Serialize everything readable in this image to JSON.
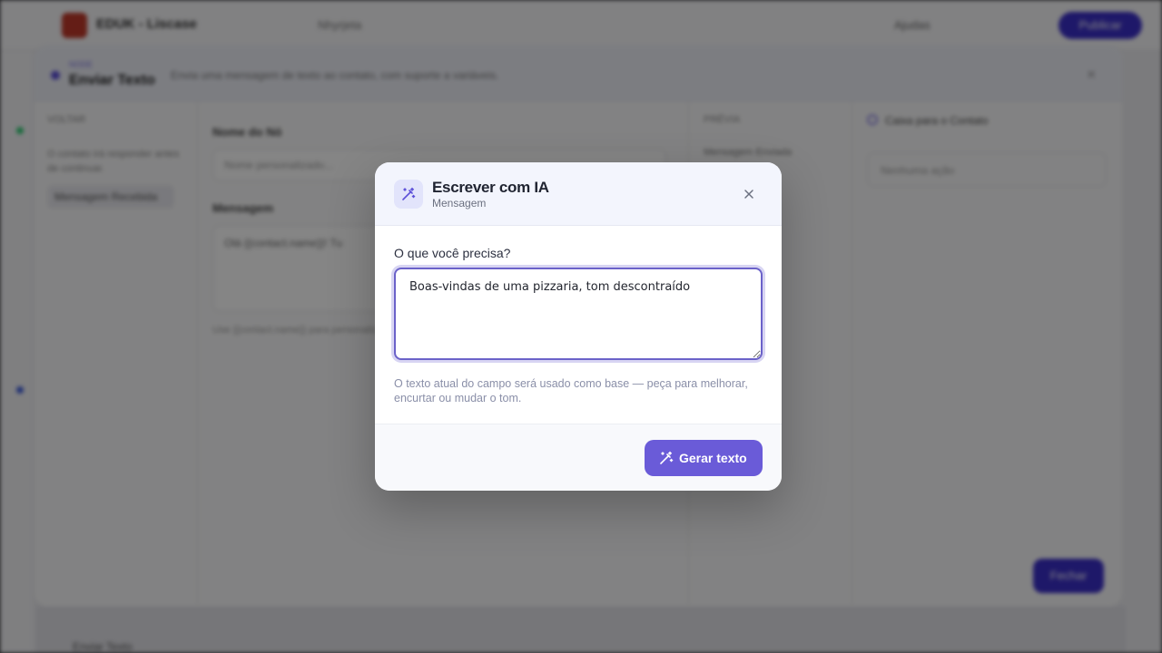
{
  "background_app": {
    "brand": "EDUK - Liscase",
    "top_center": "Nhyrjeta",
    "help": "Ajudas",
    "top_cta": "Publicar",
    "bottom_label": "Enviar Texto"
  },
  "editor_panel": {
    "kicker": "NODE",
    "title": "Enviar Texto",
    "description": "Envia uma mensagem de texto ao contato, com suporte a variáveis.",
    "left_col_header": "VOLTAR",
    "left_col_text": "O contato irá responder antes de continuar.",
    "left_col_chip": "Mensagem Recebida",
    "name_label": "Nome do Nó",
    "name_placeholder": "Nome personalizado...",
    "message_label": "Mensagem",
    "message_value": "Olá {{contact.name}}! Tu",
    "message_hint": "Use {{contact.name}} para personalizar",
    "preview_header": "PRÉVIA",
    "preview_sub": "Mensagem Enviada",
    "right_header": "Caixa para o Contato",
    "right_box": "Nenhuma ação",
    "save_button": "Fechar"
  },
  "modal": {
    "title": "Escrever com IA",
    "subtitle": "Mensagem",
    "prompt_label": "O que você precisa?",
    "prompt_value": "Boas-vindas de uma pizzaria, tom descontraído",
    "help_text": "O texto atual do campo será usado como base — peça para melhorar, encurtar ou mudar o tom.",
    "generate_button": "Gerar texto",
    "icons": {
      "header": "magic-wand-icon",
      "close": "close-icon",
      "button": "magic-wand-icon"
    },
    "colors": {
      "accent": "#6a5bd8",
      "focus_border": "#6b62c9"
    }
  }
}
